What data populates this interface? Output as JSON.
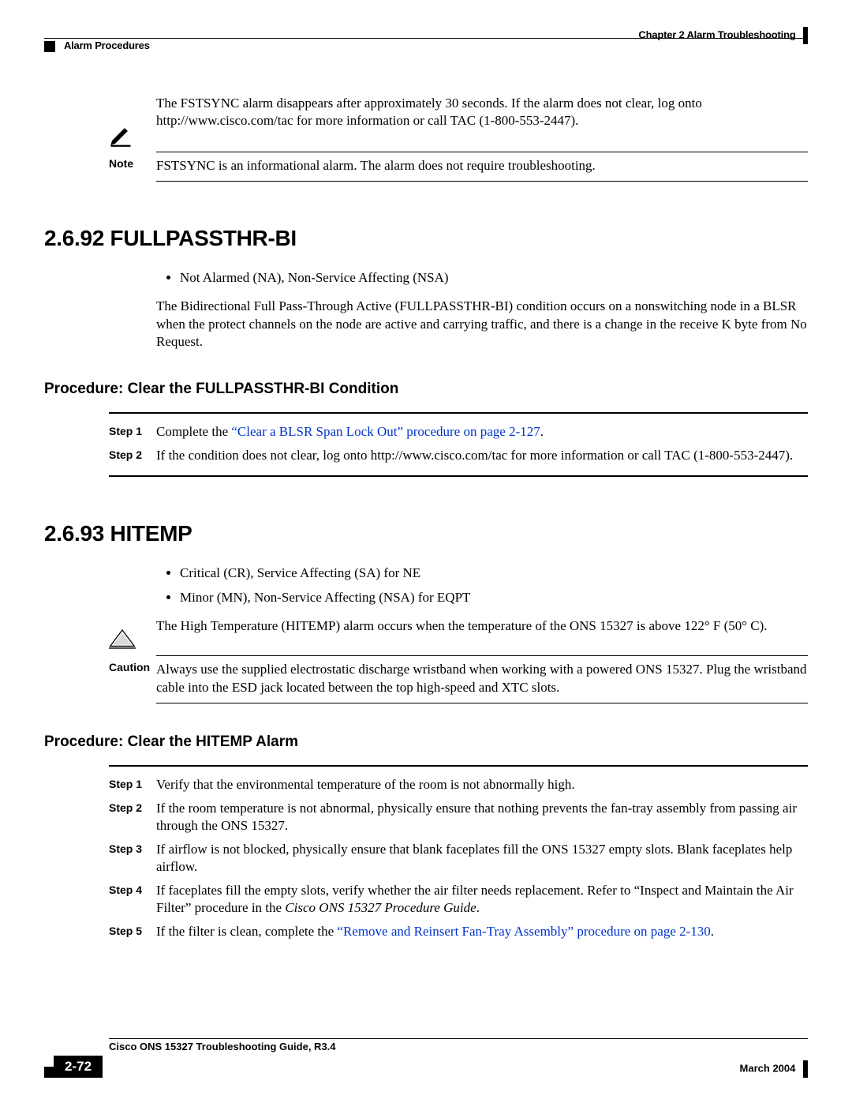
{
  "header": {
    "chapter": "Chapter 2      Alarm Troubleshooting",
    "section": "Alarm Procedures"
  },
  "intro_para": "The FSTSYNC alarm disappears after approximately 30 seconds. If the alarm does not clear, log onto http://www.cisco.com/tac for more information or call TAC (1-800-553-2447).",
  "note1": {
    "label": "Note",
    "text": "FSTSYNC is an informational alarm. The alarm does not require troubleshooting."
  },
  "sec_a": {
    "heading": "2.6.92  FULLPASSTHR-BI",
    "bullet1": "Not Alarmed (NA), Non-Service Affecting (NSA)",
    "para": "The Bidirectional Full Pass-Through Active (FULLPASSTHR-BI) condition occurs on a nonswitching node in a BLSR when the protect channels on the node are active and carrying traffic, and there is a change in the receive K byte from No Request.",
    "proc_heading": "Procedure: Clear the FULLPASSTHR-BI Condition",
    "step1": {
      "label": "Step 1",
      "pre": "Complete the ",
      "link": "“Clear a BLSR Span Lock Out” procedure on page 2-127",
      "post": "."
    },
    "step2": {
      "label": "Step 2",
      "text": "If the condition does not clear, log onto http://www.cisco.com/tac for more information or call TAC (1-800-553-2447)."
    }
  },
  "sec_b": {
    "heading": "2.6.93  HITEMP",
    "bullet1": "Critical (CR), Service Affecting (SA) for NE",
    "bullet2": "Minor (MN), Non-Service Affecting (NSA) for EQPT",
    "para": "The High Temperature (HITEMP) alarm occurs when the temperature of the ONS 15327 is above 122° F (50° C).",
    "caution": {
      "label": "Caution",
      "text": "Always use the supplied electrostatic discharge wristband when working with a powered ONS 15327. Plug the wristband cable into the ESD jack located between the top high-speed and XTC slots."
    },
    "proc_heading": "Procedure: Clear the HITEMP Alarm",
    "step1": {
      "label": "Step 1",
      "text": "Verify that the environmental temperature of the room is not abnormally high."
    },
    "step2": {
      "label": "Step 2",
      "text": "If the room temperature is not abnormal, physically ensure that nothing prevents the fan-tray assembly from passing air through the ONS 15327."
    },
    "step3": {
      "label": "Step 3",
      "text": "If airflow is not blocked, physically ensure that blank faceplates fill the ONS 15327 empty slots. Blank faceplates help airflow."
    },
    "step4": {
      "label": "Step 4",
      "pre": "If faceplates fill the empty slots, verify whether the air filter needs replacement. Refer to “Inspect and Maintain the Air Filter” procedure in the ",
      "italic": "Cisco ONS 15327 Procedure Guide",
      "post": "."
    },
    "step5": {
      "label": "Step 5",
      "pre": "If the filter is clean, complete the ",
      "link": "“Remove and Reinsert Fan-Tray Assembly” procedure on page 2-130",
      "post": "."
    }
  },
  "footer": {
    "title": "Cisco ONS 15327 Troubleshooting Guide, R3.4",
    "page": "2-72",
    "date": "March 2004"
  }
}
